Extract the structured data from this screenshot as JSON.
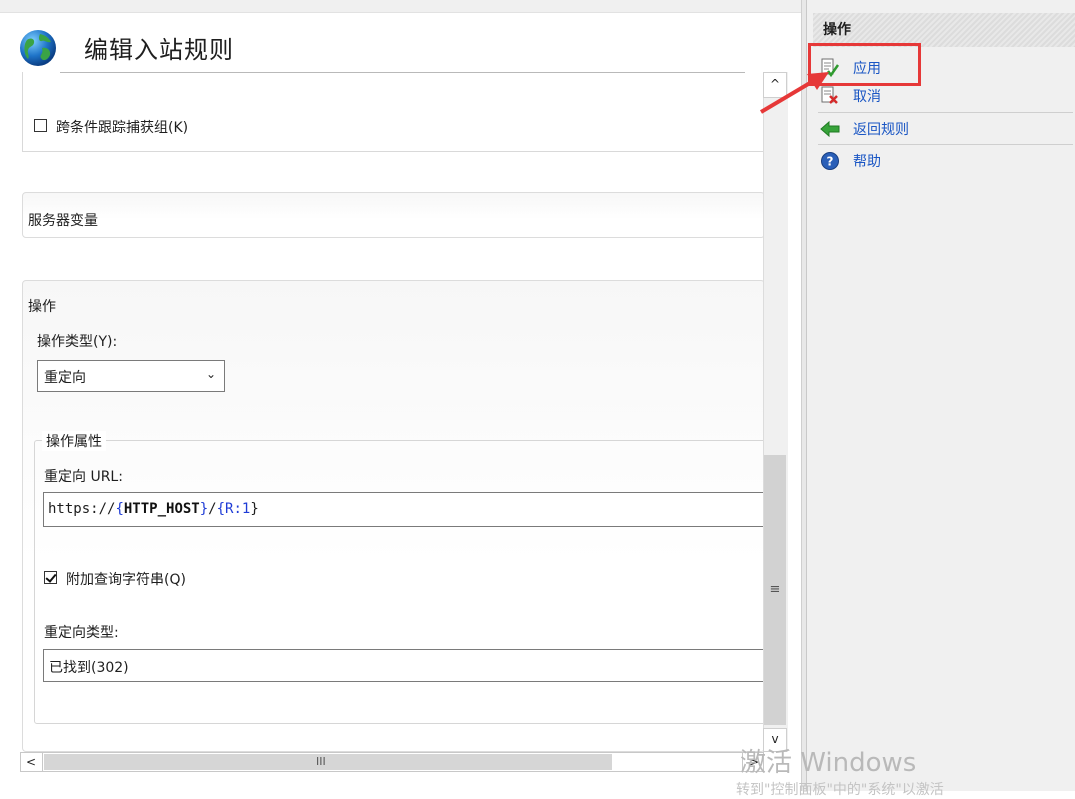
{
  "header": {
    "title": "编辑入站规则"
  },
  "conditions": {
    "track_captures_label": "跨条件跟踪捕获组(K)",
    "track_captures_checked": false
  },
  "server_variables": {
    "section_title": "服务器变量"
  },
  "action": {
    "section_title": "操作",
    "action_type_label": "操作类型(Y):",
    "action_type_value": "重定向",
    "properties_legend": "操作属性",
    "redirect_url_label": "重定向 URL:",
    "redirect_url_parts": {
      "p1": "https://",
      "p2": "{",
      "p3": "HTTP_HOST",
      "p4": "}",
      "p5": "/",
      "p6": "{",
      "p7": "R:1",
      "p8": "}"
    },
    "append_query_label": "附加查询字符串(Q)",
    "append_query_checked": true,
    "redirect_type_label": "重定向类型:",
    "redirect_type_value": "已找到(302)"
  },
  "scrollbars": {
    "up_arrow": "^",
    "down_arrow": "v",
    "left_arrow": "<",
    "right_arrow": ">",
    "v_grip": "≡",
    "h_grip": "III"
  },
  "actions_pane": {
    "header": "操作",
    "items": [
      {
        "label": "应用",
        "icon": "apply-icon"
      },
      {
        "label": "取消",
        "icon": "cancel-icon"
      },
      {
        "label": "返回规则",
        "icon": "back-arrow-icon"
      },
      {
        "label": "帮助",
        "icon": "help-icon"
      }
    ]
  },
  "watermark": {
    "title": "激活 Windows",
    "subtitle": "转到\"控制面板\"中的\"系统\"以激活"
  },
  "colors": {
    "link": "#1a56c4",
    "highlight": "#e63838",
    "url_token": "#1e3bd6"
  }
}
